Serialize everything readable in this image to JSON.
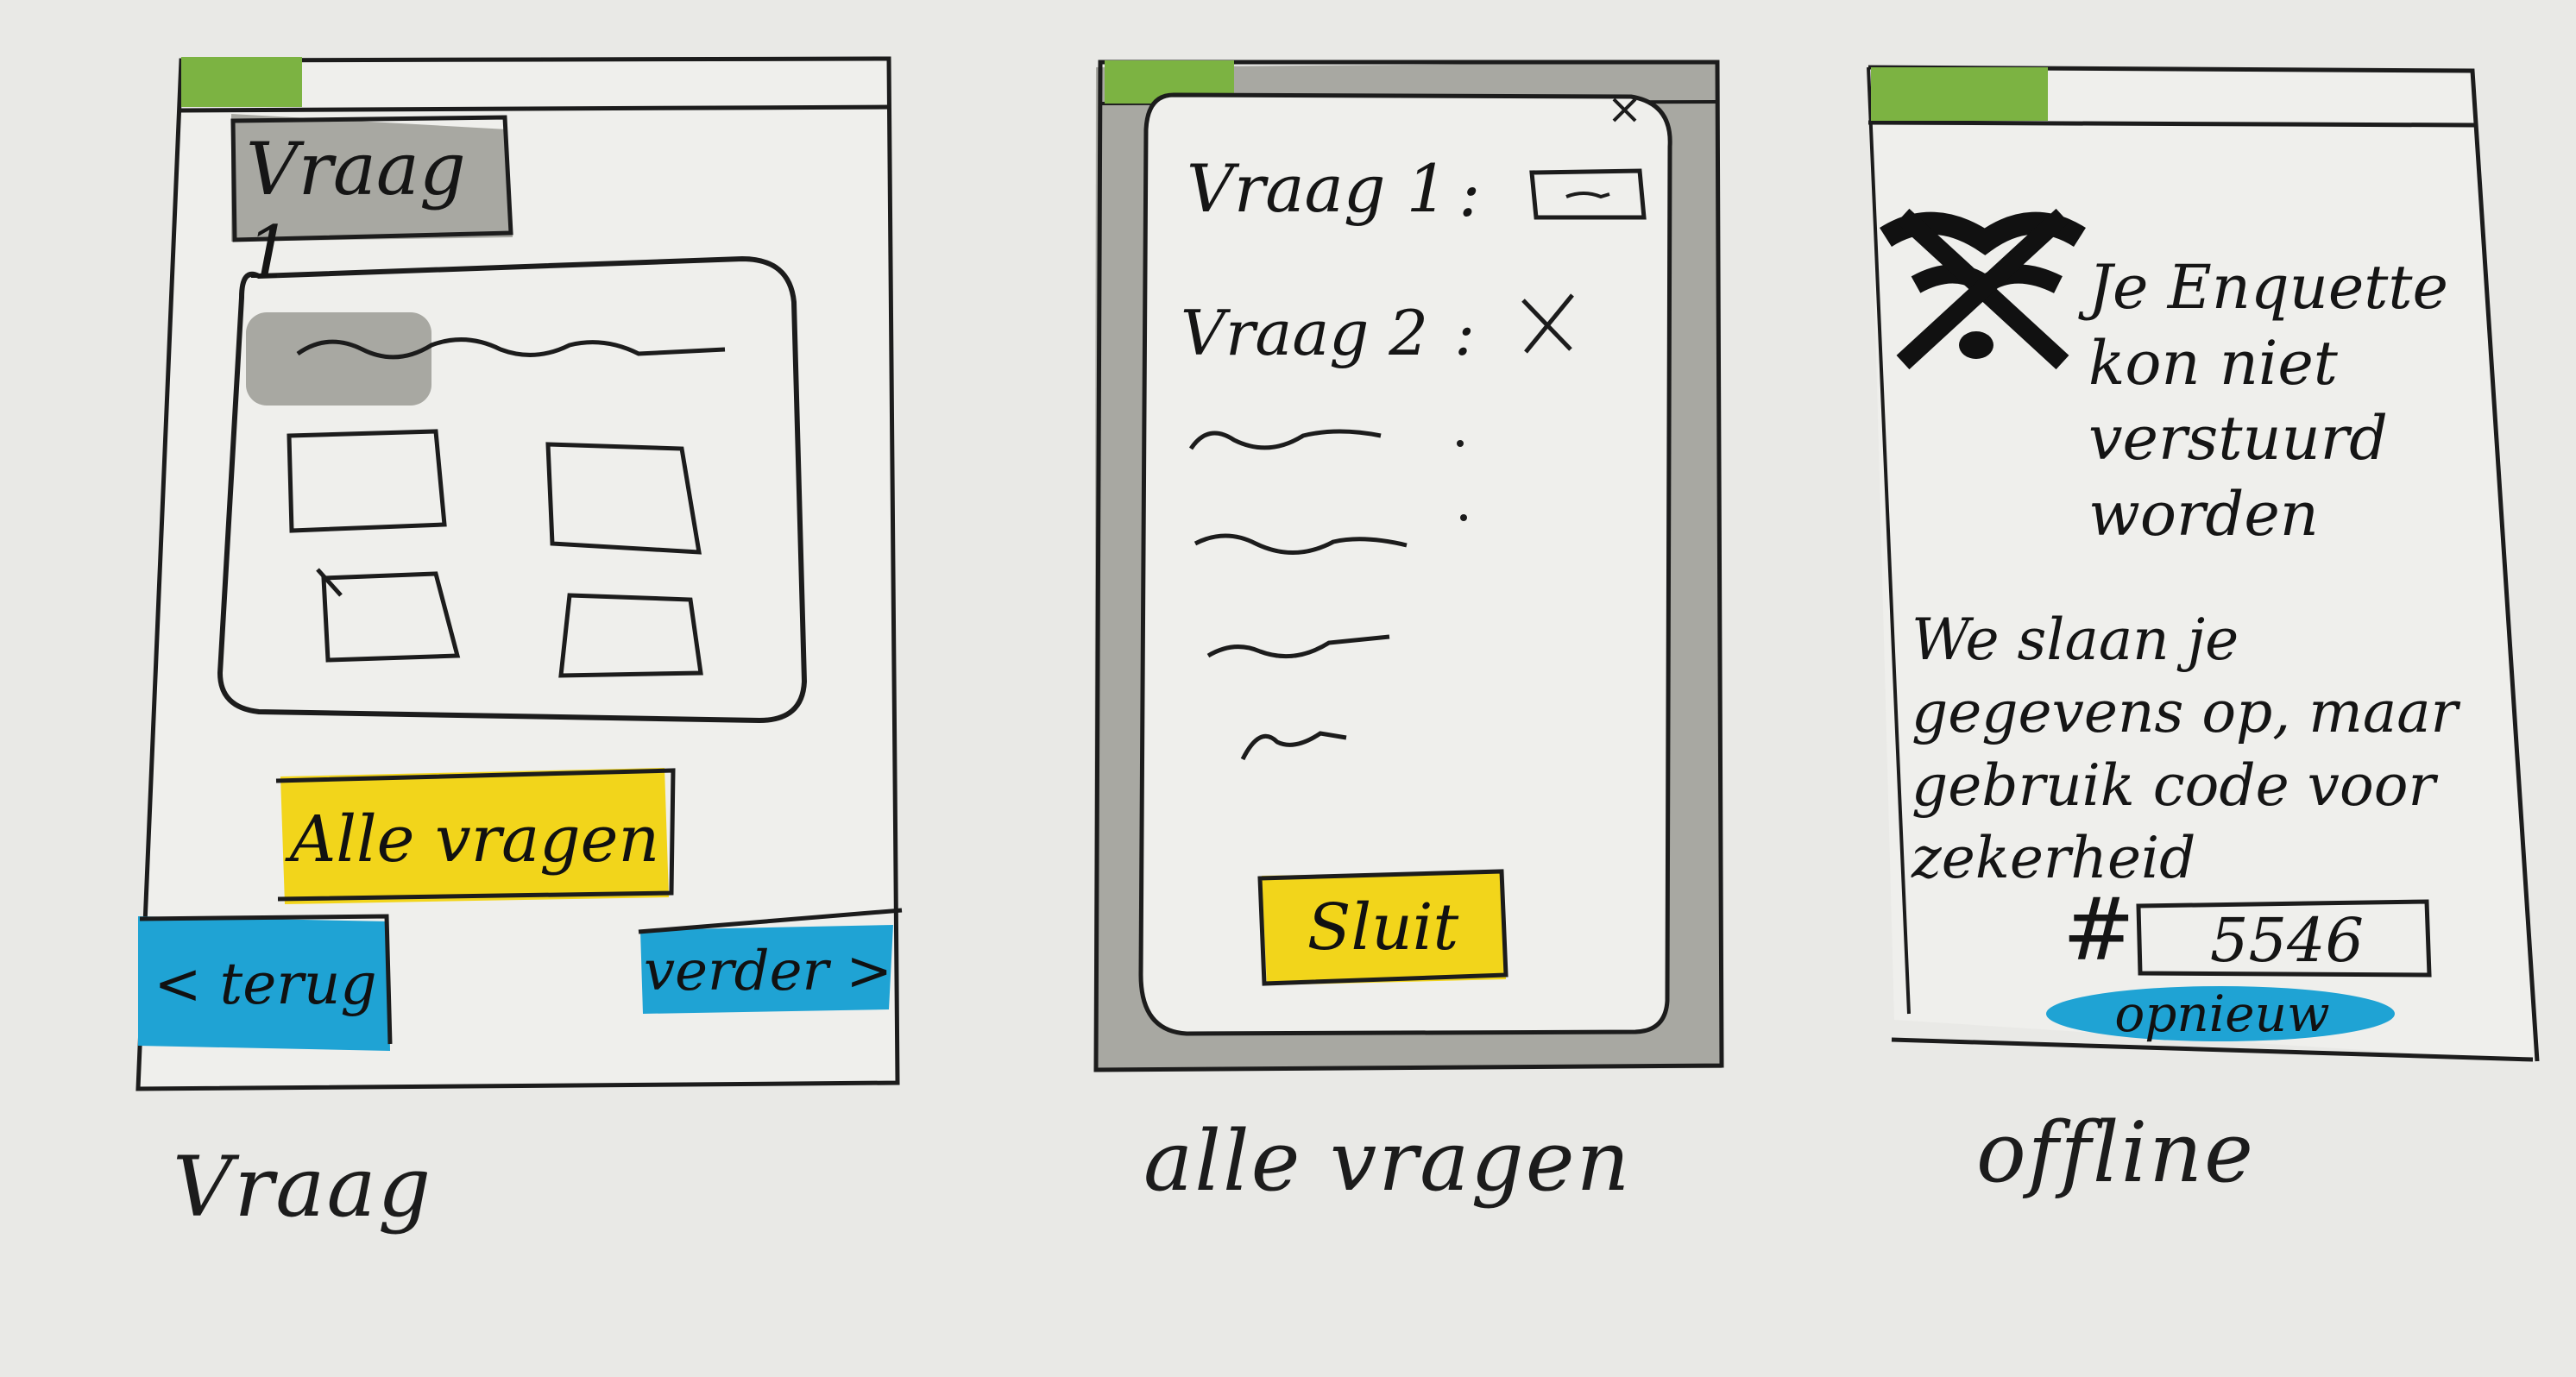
{
  "screens": {
    "vraag": {
      "caption": "Vraag",
      "question_tab": "Vraag 1",
      "all_questions_button": "Alle vragen",
      "back_button": "< terug",
      "next_button": "verder >"
    },
    "alle_vragen": {
      "caption": "alle vragen",
      "rows": [
        {
          "label": "Vraag 1",
          "sep": ":"
        },
        {
          "label": "Vraag 2",
          "sep": ":"
        }
      ],
      "close_button": "Sluit"
    },
    "offline": {
      "caption": "offline",
      "error_message": "Je Enquette kon niet verstuurd worden",
      "save_message": "We slaan je gegevens op, maar gebruik code voor zekerheid",
      "hash": "#",
      "code_value": "5546",
      "retry_button": "opnieuw"
    }
  },
  "colors": {
    "progress_green": "#7cb342",
    "button_yellow": "#f2d51b",
    "button_blue": "#1fa3d4",
    "dim_gray": "#a8a8a2",
    "ink": "#1c1c1c"
  }
}
